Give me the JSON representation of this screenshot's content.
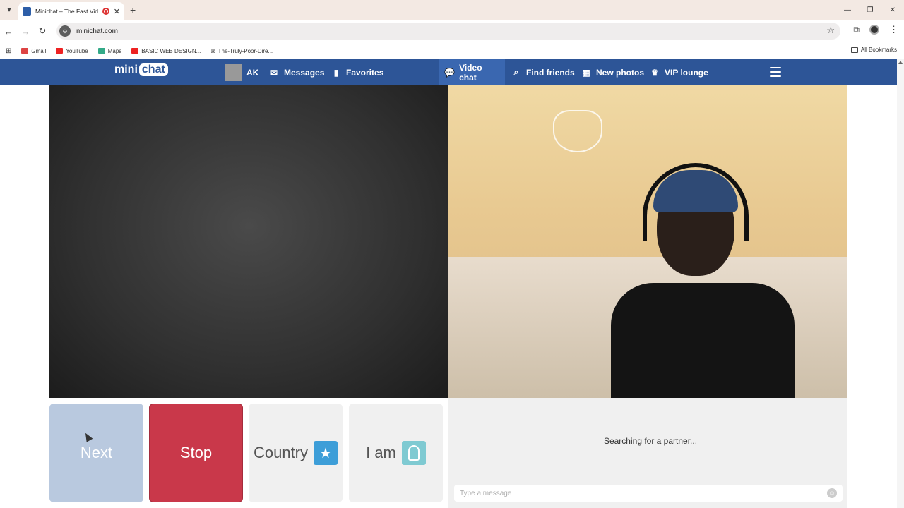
{
  "browser": {
    "tab_title": "Minichat – The Fast Video C",
    "url": "minichat.com",
    "bookmarks": [
      "Gmail",
      "YouTube",
      "Maps",
      "BASIC WEB DESIGN...",
      "The-Truly-Poor-Dire..."
    ],
    "all_bookmarks": "All Bookmarks"
  },
  "header": {
    "logo_left": "mini",
    "logo_right": "chat",
    "user_name": "AK",
    "messages": "Messages",
    "favorites": "Favorites",
    "video_chat": "Video chat",
    "find_friends": "Find friends",
    "new_photos": "New photos",
    "vip_lounge": "VIP lounge"
  },
  "controls": {
    "next": "Next",
    "stop": "Stop",
    "country": "Country",
    "i_am": "I am"
  },
  "chat": {
    "status": "Searching for a partner...",
    "placeholder": "Type a message"
  },
  "colors": {
    "header_bg": "#2d5597",
    "stop_bg": "#c9384a",
    "next_bg": "#b9c9df",
    "country_star": "#3d9ed8",
    "iam_badge": "#7fcad2"
  }
}
